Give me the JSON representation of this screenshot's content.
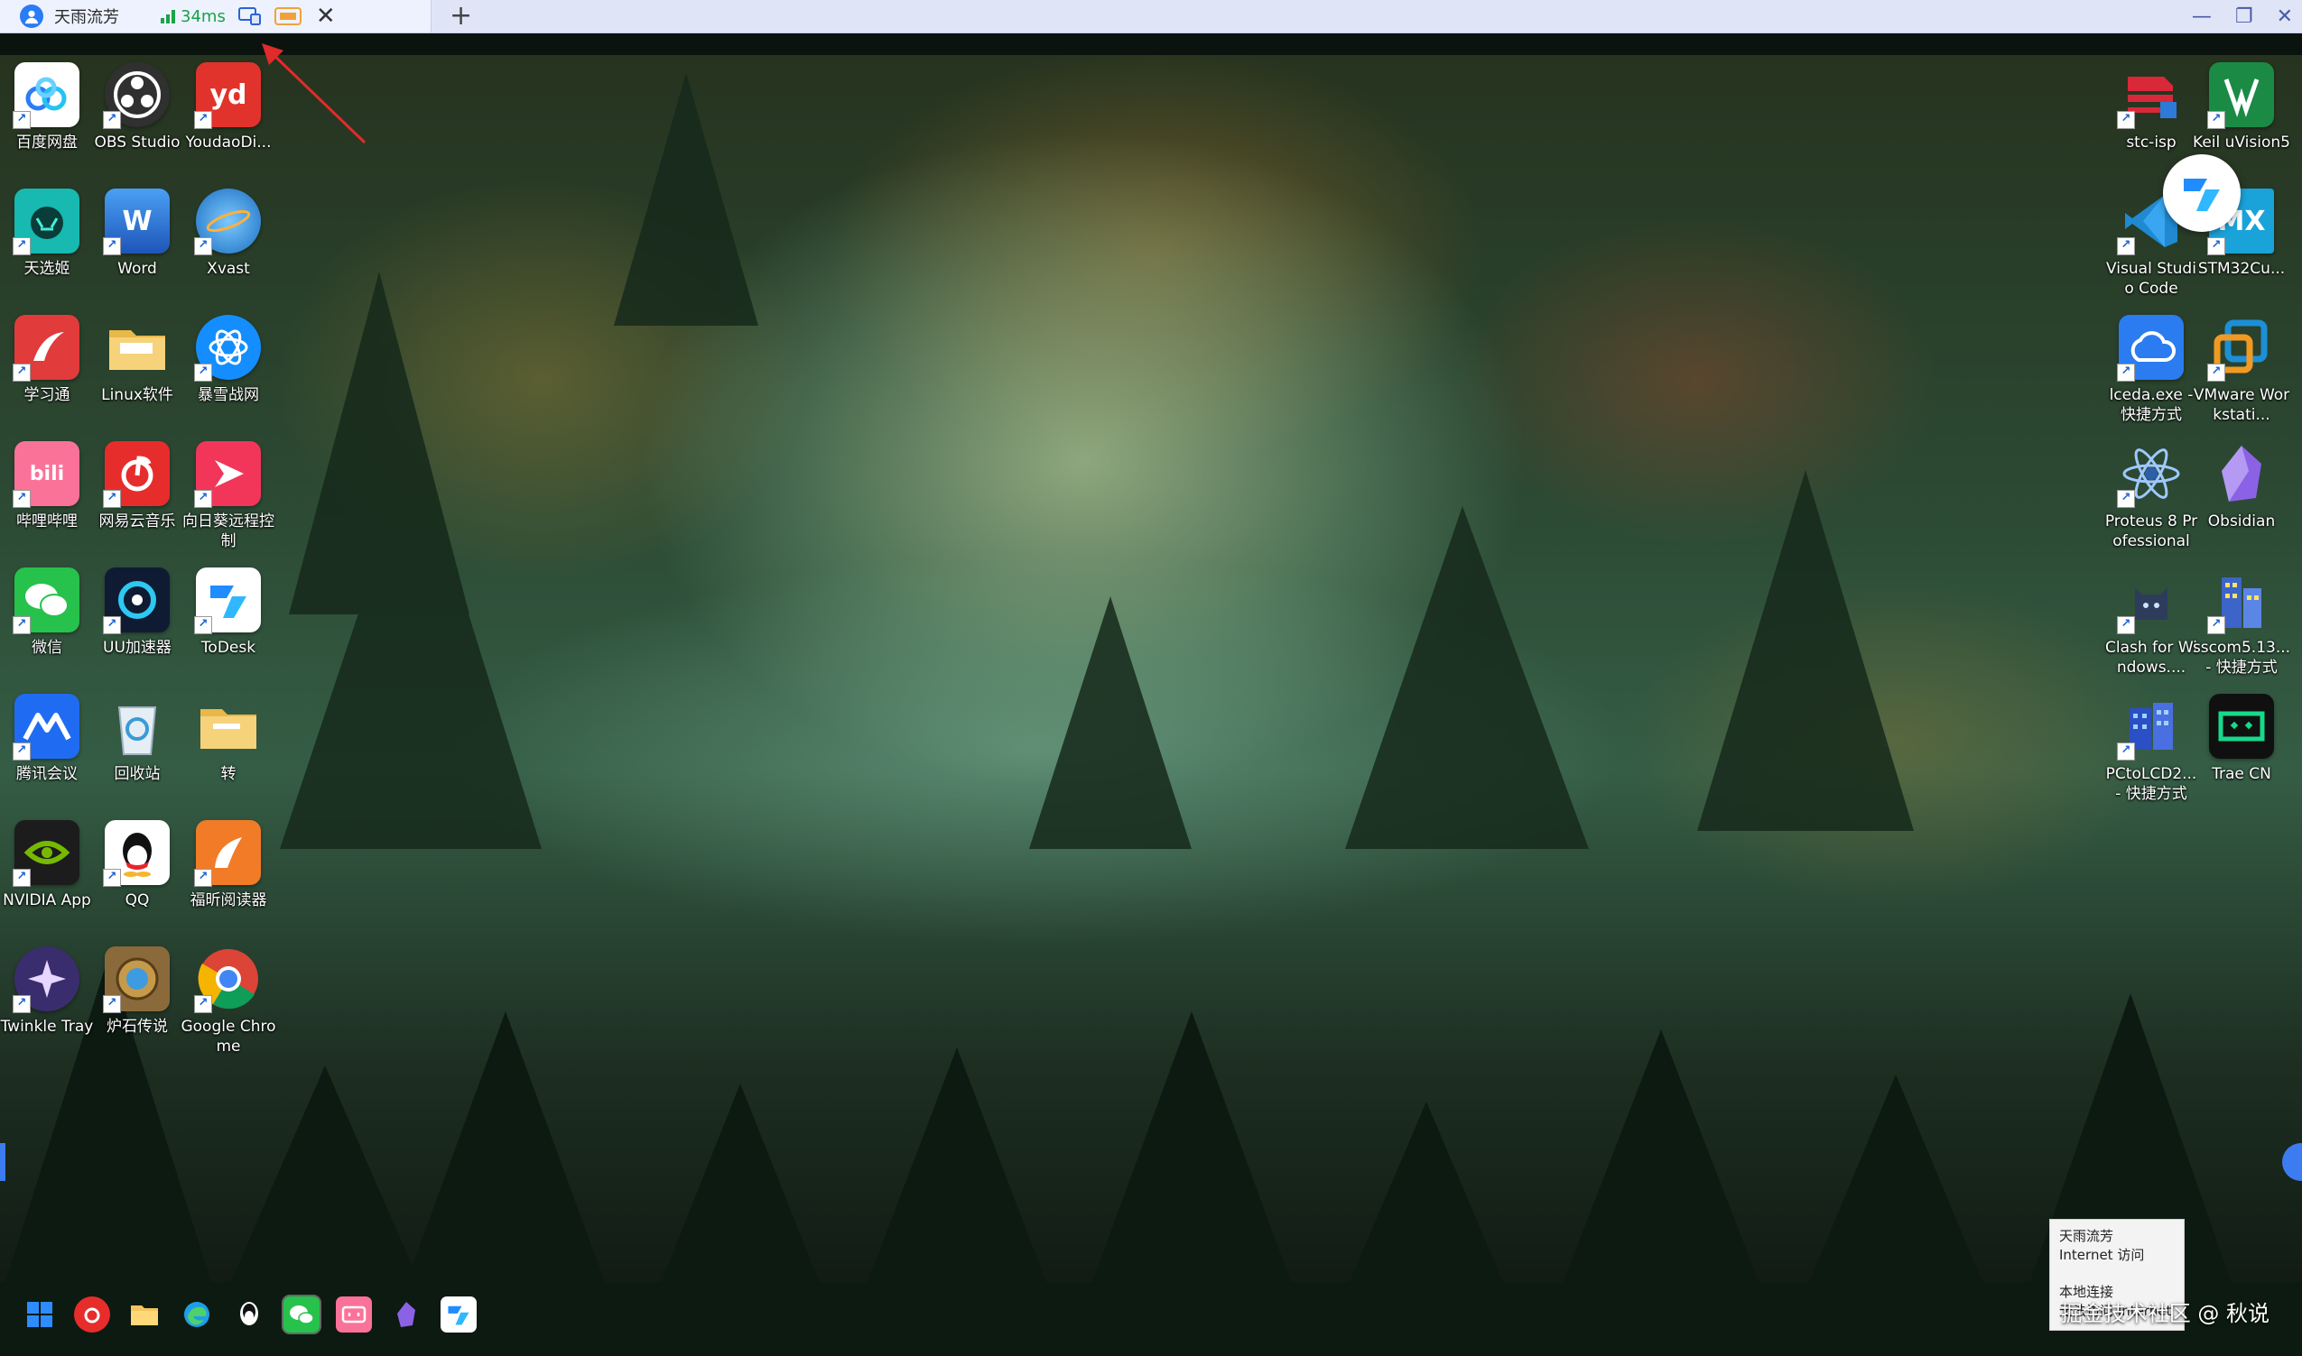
{
  "session_tab": {
    "user_name": "天雨流芳",
    "latency": "34ms"
  },
  "desktop_icons_left": [
    {
      "label": "百度网盘",
      "icon": "baidu-netdisk-icon",
      "color": "#ffffff"
    },
    {
      "label": "OBS Studio",
      "icon": "obs-icon",
      "color": "#303030"
    },
    {
      "label": "YoudaoDi...",
      "icon": "youdao-icon",
      "color": "#e2322c",
      "glyph": "yd"
    },
    {
      "label": "天选姬",
      "icon": "tianxuanji-icon",
      "color": "#17b9b0"
    },
    {
      "label": "Word",
      "icon": "word-icon",
      "color": "#2a67c8",
      "glyph": "W"
    },
    {
      "label": "Xvast",
      "icon": "xvast-icon",
      "color": "#1e8fd8"
    },
    {
      "label": "学习通",
      "icon": "xuexitong-icon",
      "color": "#e13b3b"
    },
    {
      "label": "Linux软件",
      "icon": "folder-icon",
      "color": "#f2c55c"
    },
    {
      "label": "暴雪战网",
      "icon": "battlenet-icon",
      "color": "#148eff"
    },
    {
      "label": "哔哩哔哩",
      "icon": "bilibili-icon",
      "color": "#fb7299",
      "glyph": "bili"
    },
    {
      "label": "网易云音乐",
      "icon": "netease-music-icon",
      "color": "#e72d2c"
    },
    {
      "label": "向日葵远程控制",
      "icon": "sunlogin-icon",
      "color": "#f2365a"
    },
    {
      "label": "微信",
      "icon": "wechat-icon",
      "color": "#27c24c"
    },
    {
      "label": "UU加速器",
      "icon": "uu-accelerator-icon",
      "color": "#0f1b33"
    },
    {
      "label": "ToDesk",
      "icon": "todesk-icon",
      "color": "#ffffff"
    },
    {
      "label": "腾讯会议",
      "icon": "tencent-meeting-icon",
      "color": "#1f6cf2"
    },
    {
      "label": "回收站",
      "icon": "recycle-bin-icon",
      "color": "#dfe8f0"
    },
    {
      "label": "转",
      "icon": "folder-icon",
      "color": "#f2c55c"
    },
    {
      "label": "NVIDIA App",
      "icon": "nvidia-icon",
      "color": "#1c1c1c"
    },
    {
      "label": "QQ",
      "icon": "qq-icon",
      "color": "#ffffff"
    },
    {
      "label": "福昕阅读器",
      "icon": "foxit-reader-icon",
      "color": "#f27b27"
    },
    {
      "label": "Twinkle Tray",
      "icon": "twinkle-tray-icon",
      "color": "#3a2d6e"
    },
    {
      "label": "炉石传说",
      "icon": "hearthstone-icon",
      "color": "#8a6a3a"
    },
    {
      "label": "Google Chrome",
      "icon": "chrome-icon",
      "color": "#ffffff"
    }
  ],
  "desktop_icons_right": [
    {
      "label": "stc-isp",
      "icon": "stc-isp-icon",
      "color": "#d8283a"
    },
    {
      "label": "Keil uVision5",
      "icon": "keil-icon",
      "color": "#1a8a45"
    },
    {
      "label": "Visual Studio Code",
      "icon": "vscode-icon",
      "color": "#1f8ad2"
    },
    {
      "label": "STM32Cu...",
      "icon": "stm32cube-icon",
      "color": "#1aa3d9",
      "glyph": "MX"
    },
    {
      "label": "lceda.exe - 快捷方式",
      "icon": "lceda-icon",
      "color": "#2a7cf0"
    },
    {
      "label": "VMware Workstati...",
      "icon": "vmware-icon",
      "color": "#1c8fd6"
    },
    {
      "label": "Proteus 8 Professional",
      "icon": "proteus-icon",
      "color": "#2d5fa8"
    },
    {
      "label": "Obsidian",
      "icon": "obsidian-icon",
      "color": "#7b57d8"
    },
    {
      "label": "Clash for Windows....",
      "icon": "clash-icon",
      "color": "#2a3145"
    },
    {
      "label": "sscom5.13... - 快捷方式",
      "icon": "sscom-icon",
      "color": "#3d64c8"
    },
    {
      "label": "PCtoLCD2... - 快捷方式",
      "icon": "pctolcd-icon",
      "color": "#2b4fc4"
    },
    {
      "label": "Trae CN",
      "icon": "trae-icon",
      "color": "#17a673"
    }
  ],
  "tooltip": {
    "line1": "天雨流芳",
    "line2": "Internet 访问",
    "line3": "本地连接",
    "line4": "无法访问 Internet"
  },
  "taskbar": [
    {
      "icon": "windows-start-icon",
      "color": "#2d8cff"
    },
    {
      "icon": "netease-music-icon",
      "color": "#e72d2c"
    },
    {
      "icon": "file-explorer-icon",
      "color": "#f2c55c"
    },
    {
      "icon": "edge-icon",
      "color": "#1f9ee6"
    },
    {
      "icon": "qq-icon",
      "color": "#ffffff"
    },
    {
      "icon": "wechat-icon",
      "color": "#27c24c",
      "active": true
    },
    {
      "icon": "bilibili-icon",
      "color": "#fb7299"
    },
    {
      "icon": "obsidian-icon",
      "color": "#7b57d8"
    },
    {
      "icon": "todesk-icon",
      "color": "#ffffff"
    }
  ],
  "watermark": "掘金技术社区 @ 秋说"
}
